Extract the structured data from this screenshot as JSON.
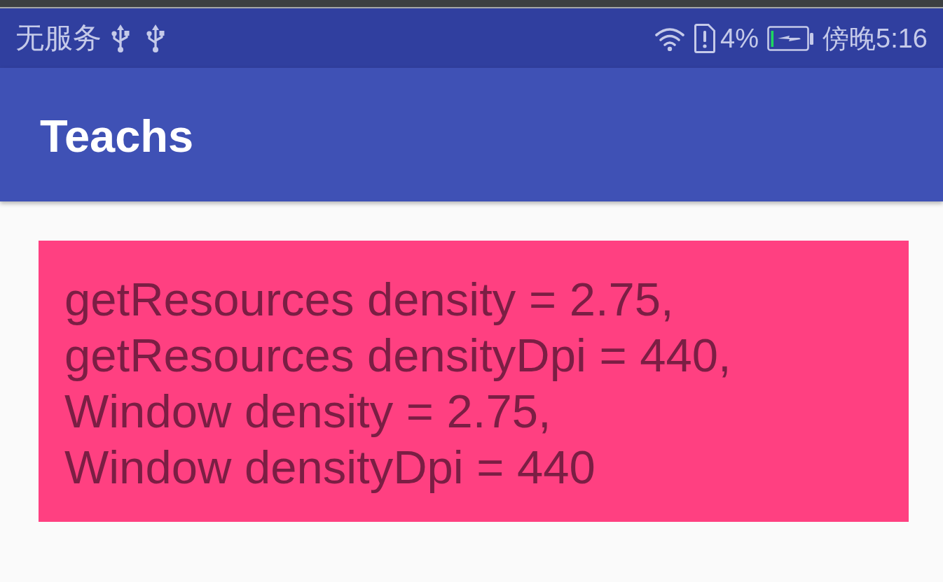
{
  "status_bar": {
    "carrier": "无服务",
    "battery_percent": "4%",
    "time": "傍晚5:16"
  },
  "app_bar": {
    "title": "Teachs"
  },
  "info_panel": {
    "lines": [
      "getResources density = 2.75,",
      "getResources densityDpi = 440,",
      "Window density = 2.75,",
      "Window densityDpi = 440"
    ]
  }
}
